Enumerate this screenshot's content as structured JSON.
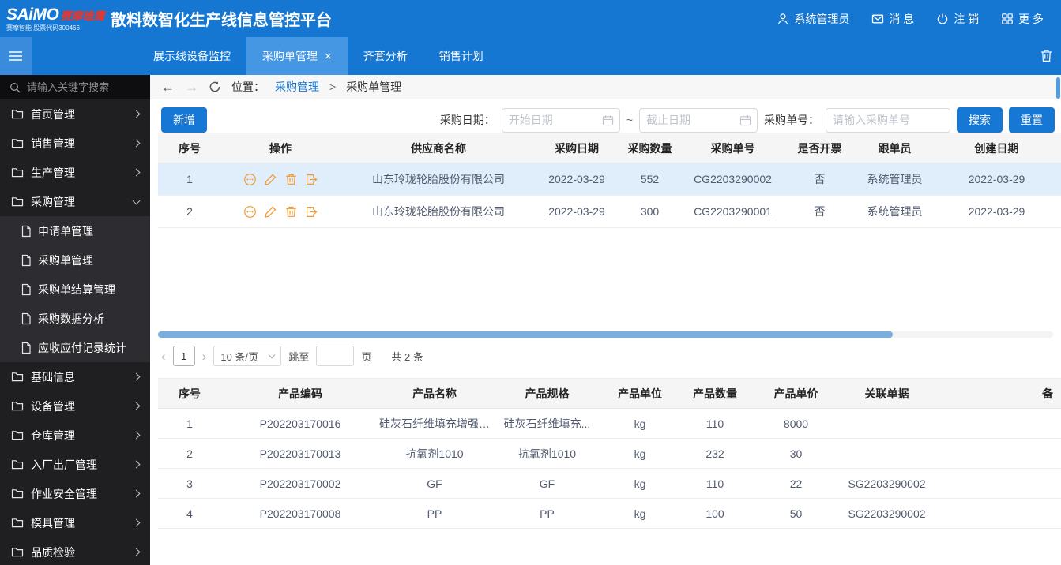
{
  "colors": {
    "primary_blue": "#1577d2",
    "active_tab_blue": "#4597e4",
    "action_icon_orange": "#f29b30",
    "selected_row_blue": "#e0edfb"
  },
  "topbar": {
    "logo_text": "SAiMO",
    "logo_red": "赛摩雄鹰",
    "logo_sub": "赛摩智能  股票代码300466",
    "title": "散料数智化生产线信息管控平台",
    "user_label": "系统管理员",
    "messages_label": "消 息",
    "logout_label": "注 销",
    "more_label": "更 多"
  },
  "tabbar": {
    "tabs": [
      {
        "label": "展示线设备监控"
      },
      {
        "label": "采购单管理",
        "close": "×"
      },
      {
        "label": "齐套分析"
      },
      {
        "label": "销售计划"
      }
    ]
  },
  "sidebar": {
    "search_placeholder": "请输入关键字搜索",
    "items": [
      "首页管理",
      "销售管理",
      "生产管理",
      "采购管理",
      "基础信息",
      "设备管理",
      "仓库管理",
      "入厂出厂管理",
      "作业安全管理",
      "模具管理",
      "品质检验"
    ],
    "submenu": [
      "申请单管理",
      "采购单管理",
      "采购单结算管理",
      "采购数据分析",
      "应收应付记录统计"
    ]
  },
  "breadcrumb": {
    "back_icon": "←",
    "forward_icon": "→",
    "label": "位置：",
    "parent": "采购管理",
    "separator": ">",
    "current": "采购单管理"
  },
  "toolbar": {
    "add_button": "新增",
    "date_label": "采购日期：",
    "date_start_placeholder": "开始日期",
    "range_separator": "~",
    "date_end_placeholder": "截止日期",
    "order_label": "采购单号：",
    "order_placeholder": "请输入采购单号",
    "search_button": "搜索",
    "reset_button": "重置"
  },
  "orders_table": {
    "headers": [
      "序号",
      "操作",
      "供应商名称",
      "采购日期",
      "采购数量",
      "采购单号",
      "是否开票",
      "跟单员",
      "创建日期"
    ],
    "rows": [
      {
        "no": "1",
        "supplier": "山东玲珑轮胎股份有限公司",
        "date": "2022-03-29",
        "qty": "552",
        "order_no": "CG2203290002",
        "invoiced": "否",
        "agent": "系统管理员",
        "created": "2022-03-29"
      },
      {
        "no": "2",
        "supplier": "山东玲珑轮胎股份有限公司",
        "date": "2022-03-29",
        "qty": "300",
        "order_no": "CG2203290001",
        "invoiced": "否",
        "agent": "系统管理员",
        "created": "2022-03-29"
      }
    ]
  },
  "pagination": {
    "prev": "‹",
    "page": "1",
    "next": "›",
    "page_size": "10 条/页",
    "jump_label": "跳至",
    "page_unit": "页",
    "total": "共 2 条"
  },
  "products_table": {
    "headers": [
      "序号",
      "产品编码",
      "产品名称",
      "产品规格",
      "产品单位",
      "产品数量",
      "产品单价",
      "关联单据",
      "备"
    ],
    "rows": [
      {
        "no": "1",
        "code": "P202203170016",
        "name": "硅灰石纤维填充增强PP",
        "spec": "硅灰石纤维填充...",
        "unit": "kg",
        "qty": "110",
        "price": "8000",
        "ref": "",
        "remark": ""
      },
      {
        "no": "2",
        "code": "P202203170013",
        "name": "抗氧剂1010",
        "spec": "抗氧剂1010",
        "unit": "kg",
        "qty": "232",
        "price": "30",
        "ref": "",
        "remark": ""
      },
      {
        "no": "3",
        "code": "P202203170002",
        "name": "GF",
        "spec": "GF",
        "unit": "kg",
        "qty": "110",
        "price": "22",
        "ref": "SG2203290002",
        "remark": ""
      },
      {
        "no": "4",
        "code": "P202203170008",
        "name": "PP",
        "spec": "PP",
        "unit": "kg",
        "qty": "100",
        "price": "50",
        "ref": "SG2203290002",
        "remark": ""
      }
    ]
  }
}
